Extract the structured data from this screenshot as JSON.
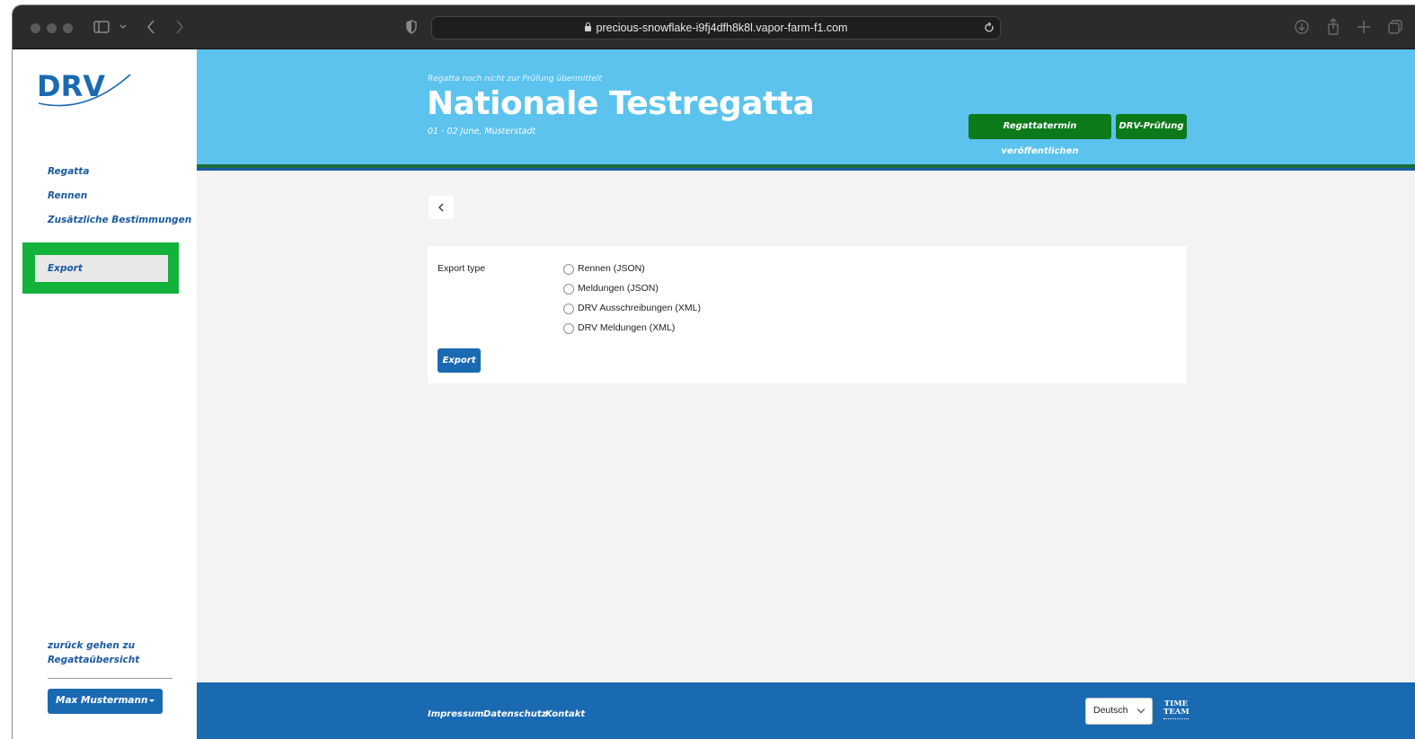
{
  "browser": {
    "url": "precious-snowflake-i9fj4dfh8k8l.vapor-farm-f1.com"
  },
  "sidebar": {
    "logo_text": "DRV",
    "items": [
      {
        "label": "Regatta"
      },
      {
        "label": "Rennen"
      },
      {
        "label": "Zusätzliche Bestimmungen"
      },
      {
        "label": "Export"
      }
    ],
    "back_link": "zurück gehen zu Regattaübersicht",
    "user_name": "Max Mustermann"
  },
  "header": {
    "status_note": "Regatta noch nicht zur Prüfung übermittelt",
    "title": "Nationale Testregatta",
    "subtitle": "01 - 02 June,  Musterstadt",
    "publish_button": "Regattatermin veröffentlichen",
    "review_button": "DRV-Prüfung"
  },
  "form": {
    "field_label": "Export type",
    "options": [
      {
        "label": "Rennen (JSON)"
      },
      {
        "label": "Meldungen (JSON)"
      },
      {
        "label": "DRV Ausschreibungen (XML)"
      },
      {
        "label": "DRV Meldungen (XML)"
      }
    ],
    "submit_label": "Export"
  },
  "footer": {
    "links": [
      {
        "label": "Impressum"
      },
      {
        "label": "Datenschutz"
      },
      {
        "label": "Kontakt"
      }
    ],
    "language": "Deutsch",
    "brand_line1": "TIME",
    "brand_line2": "TEAM"
  },
  "colors": {
    "header_bg": "#5bc3ee",
    "primary_blue": "#1a6ab2",
    "action_green": "#0c7a1a",
    "highlight_green": "#13b23b"
  }
}
